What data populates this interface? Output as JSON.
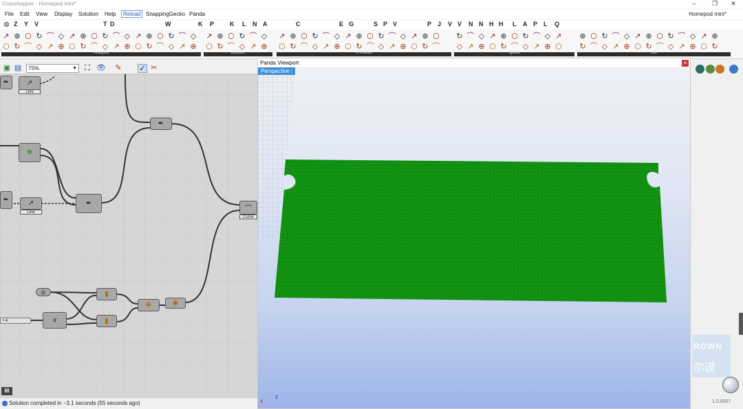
{
  "window": {
    "title": "Grasshopper - Homepod mini*",
    "controls": [
      "–",
      "❐",
      "✕"
    ]
  },
  "menu": {
    "items": [
      "File",
      "Edit",
      "View",
      "Display",
      "Solution",
      "Help",
      "Reload",
      "SnappingGecko",
      "Panda"
    ],
    "doc_name": "Homepod mini*"
  },
  "categories": [
    "Z",
    "Y",
    "V",
    "T",
    "S",
    "D",
    "W",
    "K",
    "P",
    "K",
    "L",
    "N",
    "A",
    "T",
    "C",
    "E",
    "G",
    "S",
    "P",
    "V",
    "P",
    "V",
    "J",
    "V",
    "N",
    "N",
    "H",
    "H",
    "L",
    "A",
    "P",
    "L",
    "L",
    "Q"
  ],
  "ribbon": {
    "panels": [
      "Analysis",
      "Division",
      "Primitive",
      "Spline",
      "Util"
    ]
  },
  "canvas_toolbar": {
    "zoom": "75%"
  },
  "canvas": {
    "labels": {
      "comp1_sub": "Line",
      "comp2_sub": "Line",
      "comp3_sub": "Curve",
      "slider": "• 4"
    }
  },
  "viewport": {
    "window_title": "Panda Viewport",
    "tab": "Perspective",
    "close": "×",
    "mesh_color": "#129312",
    "axis_x": "x",
    "axis_z": "z"
  },
  "status": {
    "text": "Solution completed in ~3.1 seconds (55 seconds ago)",
    "version": "1.0.0007"
  },
  "watermark": {
    "line1": "ROWN",
    "line2": "尔谟"
  }
}
